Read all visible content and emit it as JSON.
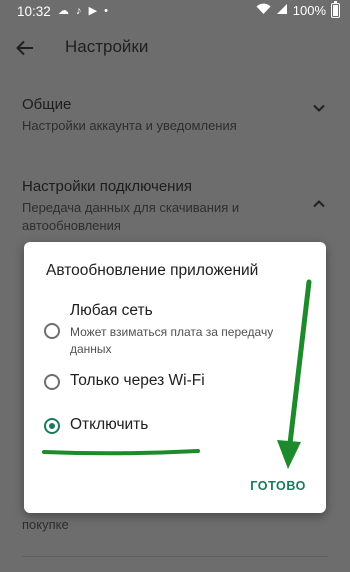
{
  "status_bar": {
    "time": "10:32",
    "left_icons": "☁ ♪ ▶ •",
    "battery": "100%"
  },
  "app_bar": {
    "title": "Настройки"
  },
  "settings": [
    {
      "title": "Общие",
      "subtitle": "Настройки аккаунта и уведомления",
      "expanded": false
    },
    {
      "title": "Настройки подключения",
      "subtitle": "Передача данных для скачивания и автообновления",
      "expanded": true
    }
  ],
  "hidden_behind": {
    "subtitle_fragment": "покупке"
  },
  "dialog": {
    "title": "Автообновление приложений",
    "options": [
      {
        "label": "Любая сеть",
        "sublabel": "Может взиматься плата за передачу данных",
        "selected": false
      },
      {
        "label": "Только через Wi-Fi",
        "selected": false
      },
      {
        "label": "Отключить",
        "selected": true
      }
    ],
    "done_label": "ГОТОВО"
  },
  "colors": {
    "accent": "#1a7a5c",
    "annotation_green": "#1d8a2c",
    "scrim": "#6d6d6d"
  }
}
